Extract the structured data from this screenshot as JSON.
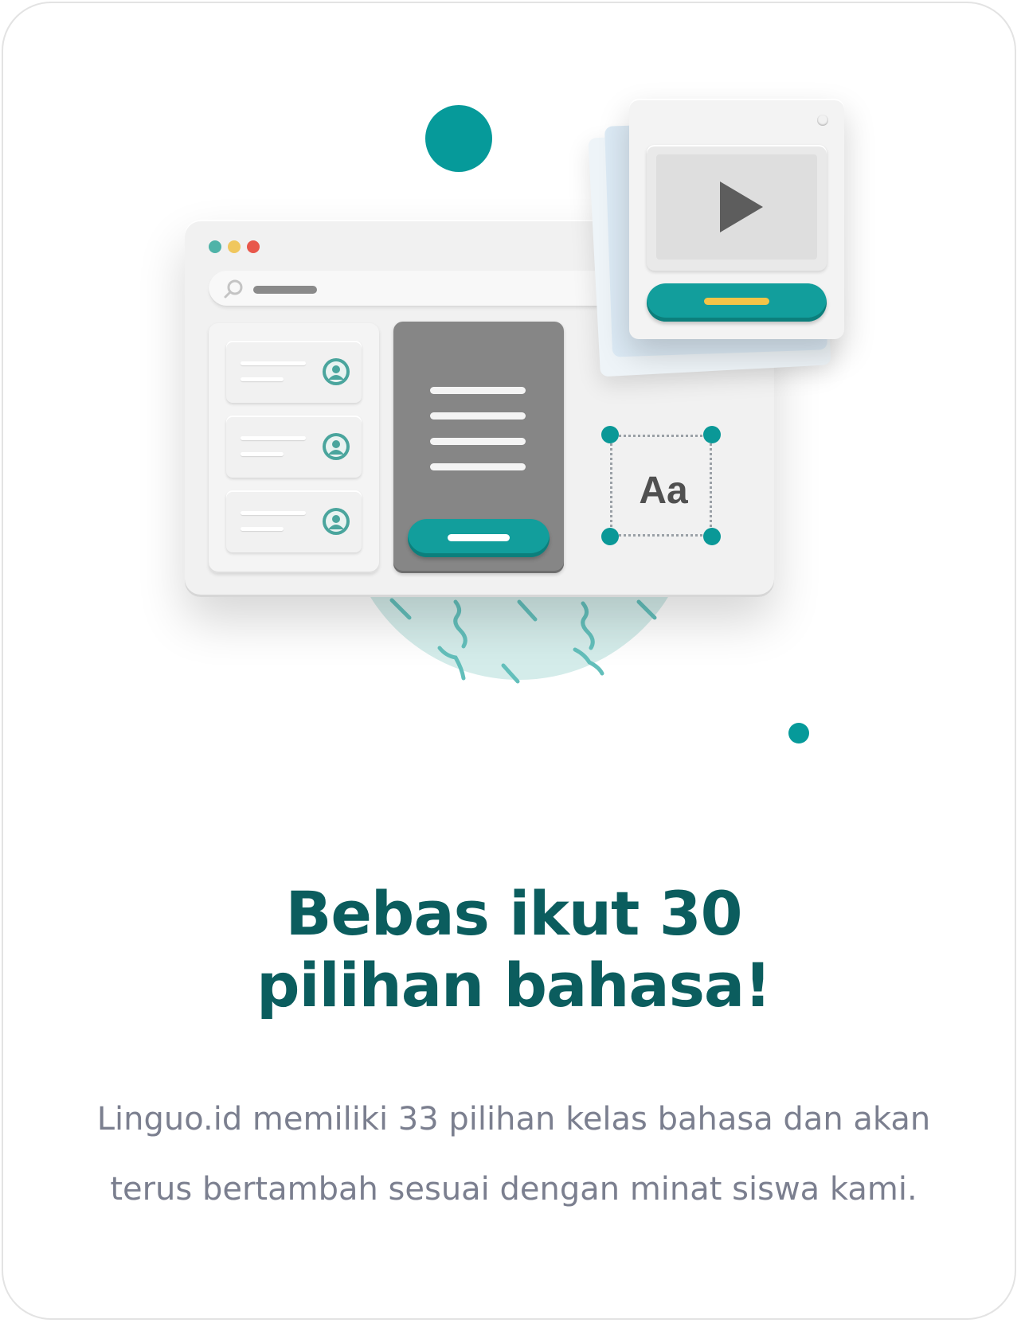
{
  "illustration": {
    "aa_label": "Aa",
    "icons": [
      "search-icon",
      "user-avatar-icon",
      "play-icon"
    ],
    "colors": {
      "teal": "#069a9a",
      "traffic_light_green": "#4fb3a8",
      "traffic_light_yellow": "#f0c75e",
      "traffic_light_red": "#e8574b",
      "accent_yellow": "#f3c447"
    }
  },
  "heading": {
    "line1": "Bebas ikut 30",
    "line2": "pilihan bahasa!"
  },
  "description": "Linguo.id memiliki 33 pilihan kelas bahasa dan akan terus bertambah sesuai dengan minat siswa kami."
}
